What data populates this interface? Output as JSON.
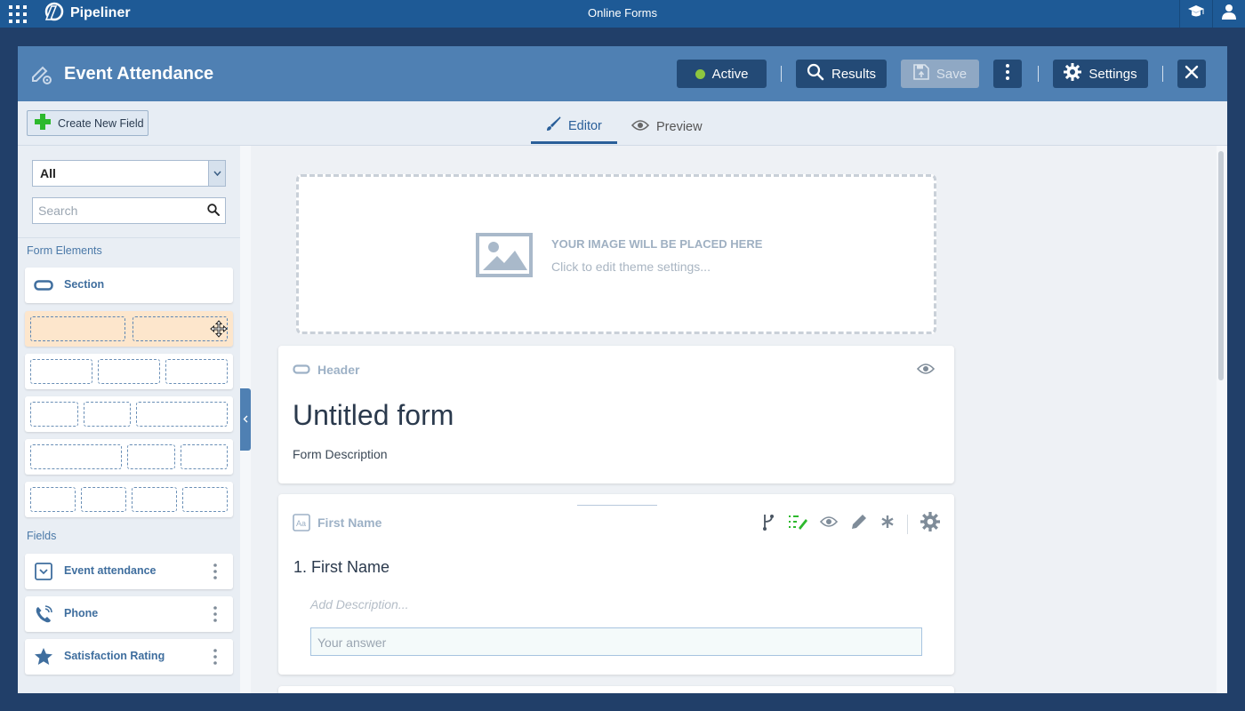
{
  "appbar": {
    "brand": "Pipeliner",
    "title": "Online Forms"
  },
  "window": {
    "title": "Event Attendance",
    "status_label": "Active",
    "status_color": "#8dc63f",
    "results_label": "Results",
    "save_label": "Save",
    "settings_label": "Settings"
  },
  "toolbar": {
    "create_field_label": "Create New Field",
    "tabs": [
      {
        "label": "Editor",
        "active": true
      },
      {
        "label": "Preview",
        "active": false
      }
    ]
  },
  "sidebar": {
    "filter_value": "All",
    "search_placeholder": "Search",
    "form_elements_label": "Form Elements",
    "section_label": "Section",
    "fields_label": "Fields",
    "fields": [
      {
        "label": "Event attendance",
        "icon": "dropdown-icon"
      },
      {
        "label": "Phone",
        "icon": "phone-icon"
      },
      {
        "label": "Satisfaction Rating",
        "icon": "star-icon"
      }
    ]
  },
  "canvas": {
    "image_placeholder_title": "YOUR IMAGE WILL BE PLACED HERE",
    "image_placeholder_hint": "Click to edit theme settings...",
    "header_card": {
      "label": "Header",
      "form_title": "Untitled form",
      "form_description": "Form Description"
    },
    "field_card": {
      "label": "First Name",
      "question": "1. First Name",
      "description_placeholder": "Add Description...",
      "answer_placeholder": "Your answer"
    }
  }
}
